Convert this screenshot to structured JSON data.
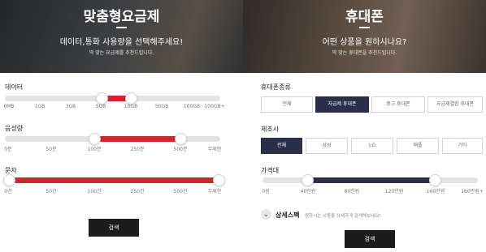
{
  "colors": {
    "red_fill": "#d0252f",
    "navy_fill": "#2a2f4a",
    "button_dark": "#1c1c1c"
  },
  "left": {
    "banner": {
      "title": "맞춤형요금제",
      "subtitle": "데이터,통화 사용량을 선택해주세요!",
      "note": "딱 맞는 요금제를 추천드립니다."
    },
    "data": {
      "label": "데이터",
      "ticks": [
        "0MB",
        "1GB",
        "3GB",
        "5GB",
        "10GB",
        "50GB",
        "100GB",
        "100GB+"
      ],
      "range": [
        "5GB",
        "10GB"
      ]
    },
    "voice": {
      "label": "음성량",
      "ticks": [
        "0분",
        "50분",
        "100분",
        "250분",
        "500분",
        "무제한"
      ],
      "range": [
        "100분",
        "500분"
      ]
    },
    "sms": {
      "label": "문자",
      "ticks": [
        "0건",
        "50건",
        "100건",
        "250건",
        "500건",
        "무제한"
      ],
      "range": [
        "0건",
        "무제한"
      ]
    },
    "search_label": "검색"
  },
  "right": {
    "banner": {
      "title": "휴대폰",
      "subtitle": "어떤 상품을 원하시나요?",
      "note": "딱 맞는 휴대폰을 추천드립니다."
    },
    "phone_type": {
      "label": "휴대폰종류",
      "options": [
        "전체",
        "자급제 휴대폰",
        "중고 휴대폰",
        "요금제결합 휴대폰"
      ],
      "selected": "자급제 휴대폰"
    },
    "maker": {
      "label": "제조사",
      "options": [
        "전체",
        "삼성",
        "LG",
        "애플",
        "기타"
      ],
      "selected": "전체"
    },
    "price": {
      "label": "가격대",
      "ticks": [
        "0원",
        "40만원",
        "80만원",
        "120만원",
        "160만원",
        "160만원+"
      ],
      "range": [
        "40만원",
        "160만원"
      ]
    },
    "detail": {
      "icon": "chevron-down-icon",
      "label": "상세스펙",
      "hint": "원하시는 상품을 상세하게 검색해보세요!"
    },
    "search_label": "검색"
  }
}
